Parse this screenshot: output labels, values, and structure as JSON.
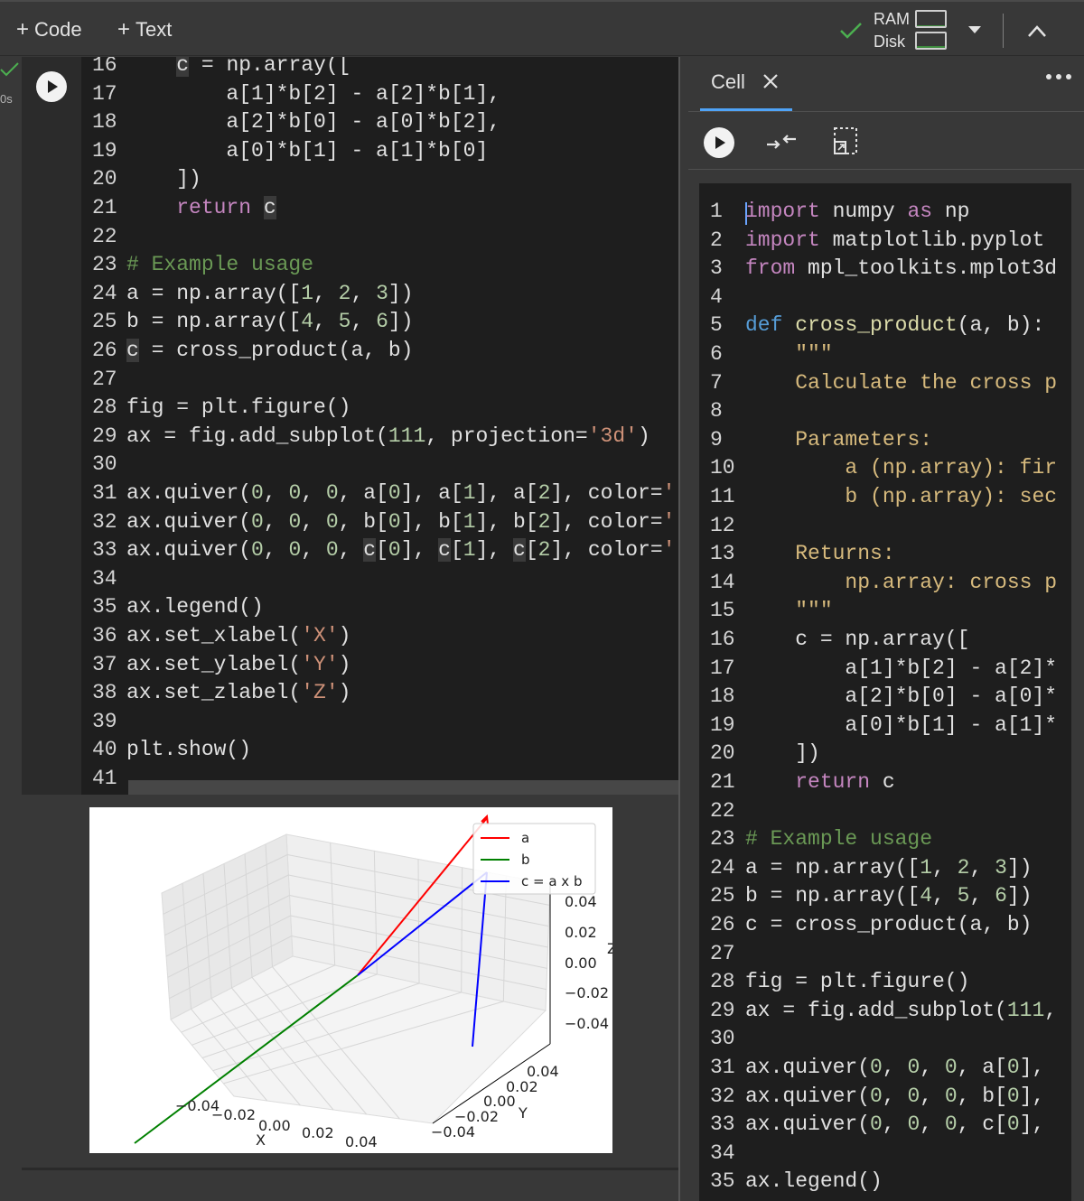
{
  "toolbar": {
    "code_label": "Code",
    "text_label": "Text",
    "ram_label": "RAM",
    "disk_label": "Disk",
    "ram_usage": 0.08,
    "disk_usage": 0.15
  },
  "cell": {
    "exec_time": "0s"
  },
  "editor_lines": [
    {
      "n": "16",
      "html": "    <span class=\"hl\">c</span> = np.array(["
    },
    {
      "n": "17",
      "html": "        a[1]*b[2] - a[2]*b[1],"
    },
    {
      "n": "18",
      "html": "        a[2]*b[0] - a[0]*b[2],"
    },
    {
      "n": "19",
      "html": "        a[0]*b[1] - a[1]*b[0]"
    },
    {
      "n": "20",
      "html": "    ])"
    },
    {
      "n": "21",
      "html": "    <span class=\"kw\">return</span> <span class=\"hl\">c</span>"
    },
    {
      "n": "22",
      "html": ""
    },
    {
      "n": "23",
      "html": "<span class=\"cmt\"># Example usage</span>"
    },
    {
      "n": "24",
      "html": "a = np.array([<span class=\"num\">1</span>, <span class=\"num\">2</span>, <span class=\"num\">3</span>])"
    },
    {
      "n": "25",
      "html": "b = np.array([<span class=\"num\">4</span>, <span class=\"num\">5</span>, <span class=\"num\">6</span>])"
    },
    {
      "n": "26",
      "html": "<span class=\"hl\">c</span> = cross_product(a, b)"
    },
    {
      "n": "27",
      "html": ""
    },
    {
      "n": "28",
      "html": "fig = plt.figure()"
    },
    {
      "n": "29",
      "html": "ax = fig.add_subplot(<span class=\"num\">111</span>, projection=<span class=\"str\">'3d'</span>)"
    },
    {
      "n": "30",
      "html": ""
    },
    {
      "n": "31",
      "html": "ax.quiver(<span class=\"num\">0</span>, <span class=\"num\">0</span>, <span class=\"num\">0</span>, a[<span class=\"num\">0</span>], a[<span class=\"num\">1</span>], a[<span class=\"num\">2</span>], color=<span class=\"str\">'</span>"
    },
    {
      "n": "32",
      "html": "ax.quiver(<span class=\"num\">0</span>, <span class=\"num\">0</span>, <span class=\"num\">0</span>, b[<span class=\"num\">0</span>], b[<span class=\"num\">1</span>], b[<span class=\"num\">2</span>], color=<span class=\"str\">'</span>"
    },
    {
      "n": "33",
      "html": "ax.quiver(<span class=\"num\">0</span>, <span class=\"num\">0</span>, <span class=\"num\">0</span>, <span class=\"hl\">c</span>[<span class=\"num\">0</span>], <span class=\"hl\">c</span>[<span class=\"num\">1</span>], <span class=\"hl\">c</span>[<span class=\"num\">2</span>], color=<span class=\"str\">'</span>"
    },
    {
      "n": "34",
      "html": ""
    },
    {
      "n": "35",
      "html": "ax.legend()"
    },
    {
      "n": "36",
      "html": "ax.set_xlabel(<span class=\"str\">'X'</span>)"
    },
    {
      "n": "37",
      "html": "ax.set_ylabel(<span class=\"str\">'Y'</span>)"
    },
    {
      "n": "38",
      "html": "ax.set_zlabel(<span class=\"str\">'Z'</span>)"
    },
    {
      "n": "39",
      "html": ""
    },
    {
      "n": "40",
      "html": "plt.show()"
    },
    {
      "n": "41",
      "html": ""
    }
  ],
  "panel": {
    "tab_label": "Cell",
    "lines": [
      {
        "n": "1",
        "html": "<span class=\"kw\">import</span> numpy <span class=\"kw\">as</span> np"
      },
      {
        "n": "2",
        "html": "<span class=\"kw\">import</span> matplotlib.pyplot"
      },
      {
        "n": "3",
        "html": "<span class=\"kw\">from</span> mpl_toolkits.mplot3d"
      },
      {
        "n": "4",
        "html": ""
      },
      {
        "n": "5",
        "html": "<span class=\"kwb\">def</span> <span class=\"fn\">cross_product</span>(a, b):"
      },
      {
        "n": "6",
        "html": "    <span class=\"doc\">\"\"\"</span>"
      },
      {
        "n": "7",
        "html": "    <span class=\"doc\">Calculate the cross p</span>"
      },
      {
        "n": "8",
        "html": ""
      },
      {
        "n": "9",
        "html": "    <span class=\"doc\">Parameters:</span>"
      },
      {
        "n": "10",
        "html": "        <span class=\"doc\">a (np.array): fir</span>"
      },
      {
        "n": "11",
        "html": "        <span class=\"doc\">b (np.array): sec</span>"
      },
      {
        "n": "12",
        "html": ""
      },
      {
        "n": "13",
        "html": "    <span class=\"doc\">Returns:</span>"
      },
      {
        "n": "14",
        "html": "        <span class=\"doc\">np.array: cross p</span>"
      },
      {
        "n": "15",
        "html": "    <span class=\"doc\">\"\"\"</span>"
      },
      {
        "n": "16",
        "html": "    c = np.array(["
      },
      {
        "n": "17",
        "html": "        a[1]*b[2] - a[2]*"
      },
      {
        "n": "18",
        "html": "        a[2]*b[0] - a[0]*"
      },
      {
        "n": "19",
        "html": "        a[0]*b[1] - a[1]*"
      },
      {
        "n": "20",
        "html": "    ])"
      },
      {
        "n": "21",
        "html": "    <span class=\"kw\">return</span> c"
      },
      {
        "n": "22",
        "html": ""
      },
      {
        "n": "23",
        "html": "<span class=\"cmt\"># Example usage</span>"
      },
      {
        "n": "24",
        "html": "a = np.array([<span class=\"num\">1</span>, <span class=\"num\">2</span>, <span class=\"num\">3</span>])"
      },
      {
        "n": "25",
        "html": "b = np.array([<span class=\"num\">4</span>, <span class=\"num\">5</span>, <span class=\"num\">6</span>])"
      },
      {
        "n": "26",
        "html": "c = cross_product(a, b)"
      },
      {
        "n": "27",
        "html": ""
      },
      {
        "n": "28",
        "html": "fig = plt.figure()"
      },
      {
        "n": "29",
        "html": "ax = fig.add_subplot(<span class=\"num\">111</span>,"
      },
      {
        "n": "30",
        "html": ""
      },
      {
        "n": "31",
        "html": "ax.quiver(<span class=\"num\">0</span>, <span class=\"num\">0</span>, <span class=\"num\">0</span>, a[<span class=\"num\">0</span>],"
      },
      {
        "n": "32",
        "html": "ax.quiver(<span class=\"num\">0</span>, <span class=\"num\">0</span>, <span class=\"num\">0</span>, b[<span class=\"num\">0</span>],"
      },
      {
        "n": "33",
        "html": "ax.quiver(<span class=\"num\">0</span>, <span class=\"num\">0</span>, <span class=\"num\">0</span>, c[<span class=\"num\">0</span>],"
      },
      {
        "n": "34",
        "html": ""
      },
      {
        "n": "35",
        "html": "ax.legend()"
      }
    ]
  },
  "plot": {
    "legend": [
      "a",
      "b",
      "c = a x b"
    ],
    "colors": {
      "a": "#ff0000",
      "b": "#008000",
      "c": "#0000ff"
    },
    "x_ticks": [
      "−0.04",
      "−0.02",
      "0.00",
      "0.02",
      "0.04"
    ],
    "y_ticks": [
      "−0.04",
      "−0.02",
      "0.00",
      "0.02",
      "0.04"
    ],
    "z_ticks": [
      "0.04",
      "0.02",
      "0.00",
      "−0.02",
      "−0.04"
    ],
    "x_label": "X",
    "y_label": "Y",
    "z_label": "Z"
  }
}
